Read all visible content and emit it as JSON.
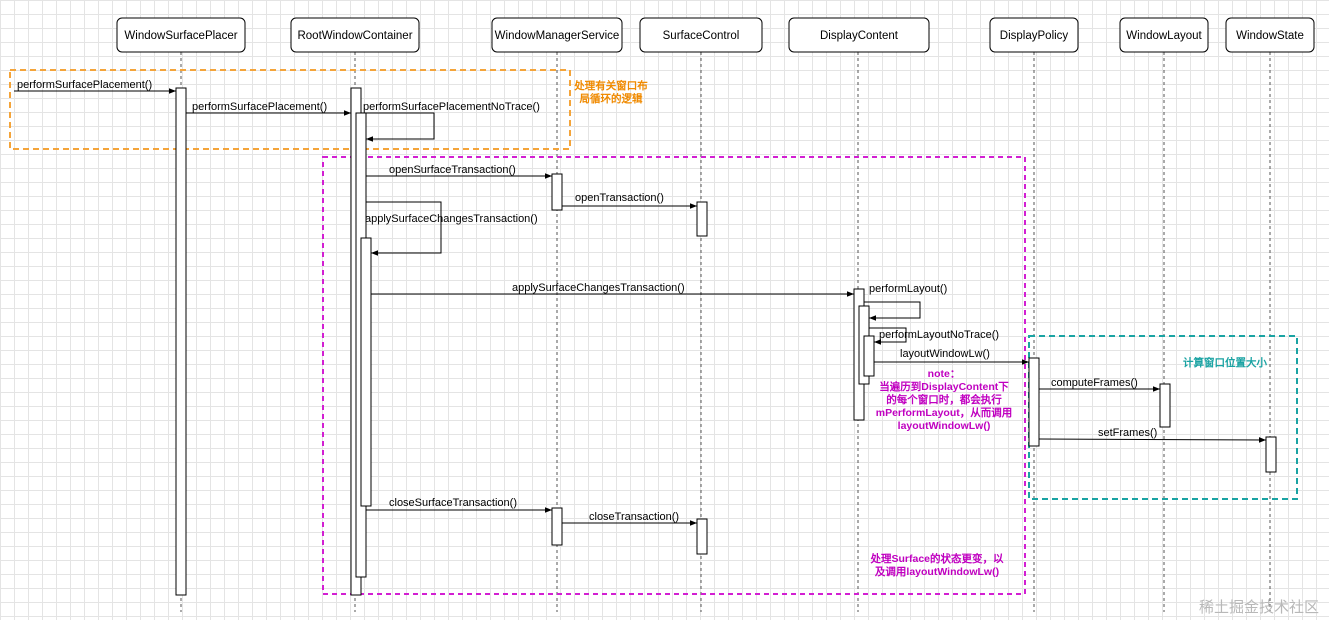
{
  "participants": [
    {
      "name": "WindowSurfacePlacer"
    },
    {
      "name": "RootWindowContainer"
    },
    {
      "name": "WindowManagerService"
    },
    {
      "name": "SurfaceControl"
    },
    {
      "name": "DisplayContent"
    },
    {
      "name": "DisplayPolicy"
    },
    {
      "name": "WindowLayout"
    },
    {
      "name": "WindowState"
    }
  ],
  "messages": {
    "m1": "performSurfacePlacement()",
    "m2": "performSurfacePlacement()",
    "m3": "performSurfacePlacementNoTrace()",
    "m4": "openSurfaceTransaction()",
    "m5": "openTransaction()",
    "m6": "applySurfaceChangesTransaction()",
    "m7": "applySurfaceChangesTransaction()",
    "m8": "performLayout()",
    "m9": "performLayoutNoTrace()",
    "m10": "layoutWindowLw()",
    "m11": "computeFrames()",
    "m12": "setFrames()",
    "m13": "closeSurfaceTransaction()",
    "m14": "closeTransaction()"
  },
  "notes": {
    "loop": [
      "处理有关窗口布",
      "局循环的逻辑"
    ],
    "layout": [
      "note：",
      "当遍历到DisplayContent下",
      "的每个窗口时，都会执行",
      "mPerformLayout，从而调用",
      "layoutWindowLw()"
    ],
    "surface": [
      "处理Surface的状态更变，以",
      "及调用layoutWindowLw()"
    ],
    "frames": "计算窗口位置大小"
  },
  "watermark": "稀土掘金技术社区"
}
